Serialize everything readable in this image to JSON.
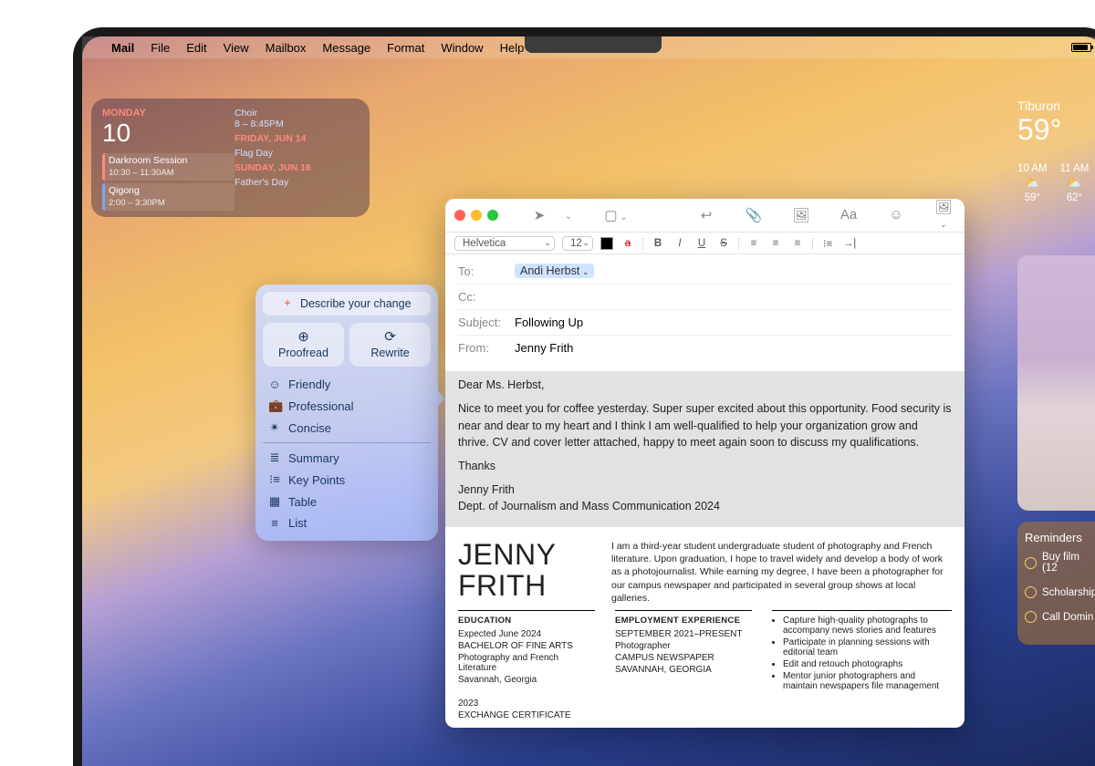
{
  "menubar": {
    "app": "Mail",
    "items": [
      "File",
      "Edit",
      "View",
      "Mailbox",
      "Message",
      "Format",
      "Window",
      "Help"
    ]
  },
  "calendar": {
    "day_name": "MONDAY",
    "day_num": "10",
    "events_left": [
      {
        "title": "Darkroom Session",
        "time": "10:30 – 11:30AM"
      },
      {
        "title": "Qigong",
        "time": "2:00 – 3:30PM"
      }
    ],
    "rows": [
      {
        "title": "Choir",
        "sub": "8 – 8:45PM",
        "cls": "lbl"
      },
      {
        "title": "FRIDAY, JUN 14",
        "cls": "hdr"
      },
      {
        "title": "Flag Day",
        "cls": "lbl"
      },
      {
        "title": "SUNDAY, JUN 16",
        "cls": "hdr"
      },
      {
        "title": "Father's Day",
        "cls": "lbl"
      }
    ]
  },
  "weather": {
    "city": "Tiburon",
    "temp": "59°",
    "hours": [
      {
        "t": "10 AM",
        "ic": "⛅",
        "v": "59°"
      },
      {
        "t": "11 AM",
        "ic": "⛅",
        "v": "62°"
      }
    ]
  },
  "reminders": {
    "title": "Reminders",
    "items": [
      "Buy film (12",
      "Scholarship",
      "Call Domin"
    ]
  },
  "ai": {
    "describe": "Describe your change",
    "proofread": "Proofread",
    "rewrite": "Rewrite",
    "tones": [
      "Friendly",
      "Professional",
      "Concise"
    ],
    "formats": [
      "Summary",
      "Key Points",
      "Table",
      "List"
    ],
    "tone_icons": [
      "☺",
      "💼",
      "✴"
    ],
    "format_icons": [
      "≣",
      "⁝≡",
      "▦",
      "≡"
    ]
  },
  "mail": {
    "font": "Helvetica",
    "size": "12",
    "to_label": "To:",
    "to_value": "Andi Herbst",
    "cc_label": "Cc:",
    "subject_label": "Subject:",
    "subject_value": "Following Up",
    "from_label": "From:",
    "from_value": "Jenny Frith",
    "greeting": "Dear Ms. Herbst,",
    "para": "Nice to meet you for coffee yesterday. Super super excited about this opportunity. Food security is near and dear to my heart and I think I am well-qualified to help your organization grow and thrive. CV and cover letter attached, happy to meet again soon to discuss my qualifications.",
    "thanks": "Thanks",
    "sig_name": "Jenny Frith",
    "sig_dept": "Dept. of Journalism and Mass Communication 2024"
  },
  "cv": {
    "first": "JENNY",
    "last": "FRITH",
    "bio": "I am a third-year student undergraduate student of photography and French literature. Upon graduation, I hope to travel widely and develop a body of work as a photojournalist. While earning my degree, I have been a photographer for our campus newspaper and participated in several group shows at local galleries.",
    "edu_h": "EDUCATION",
    "edu": [
      "Expected June 2024",
      "BACHELOR OF FINE ARTS",
      "Photography and French Literature",
      "Savannah, Georgia",
      "",
      "2023",
      "EXCHANGE CERTIFICATE"
    ],
    "emp_h": "EMPLOYMENT EXPERIENCE",
    "emp": [
      "SEPTEMBER 2021–PRESENT",
      "Photographer",
      "CAMPUS NEWSPAPER",
      "SAVANNAH, GEORGIA"
    ],
    "bullets": [
      "Capture high-quality photographs to accompany news stories and features",
      "Participate in planning sessions with editorial team",
      "Edit and retouch photographs",
      "Mentor junior photographers and maintain newspapers file management"
    ]
  }
}
